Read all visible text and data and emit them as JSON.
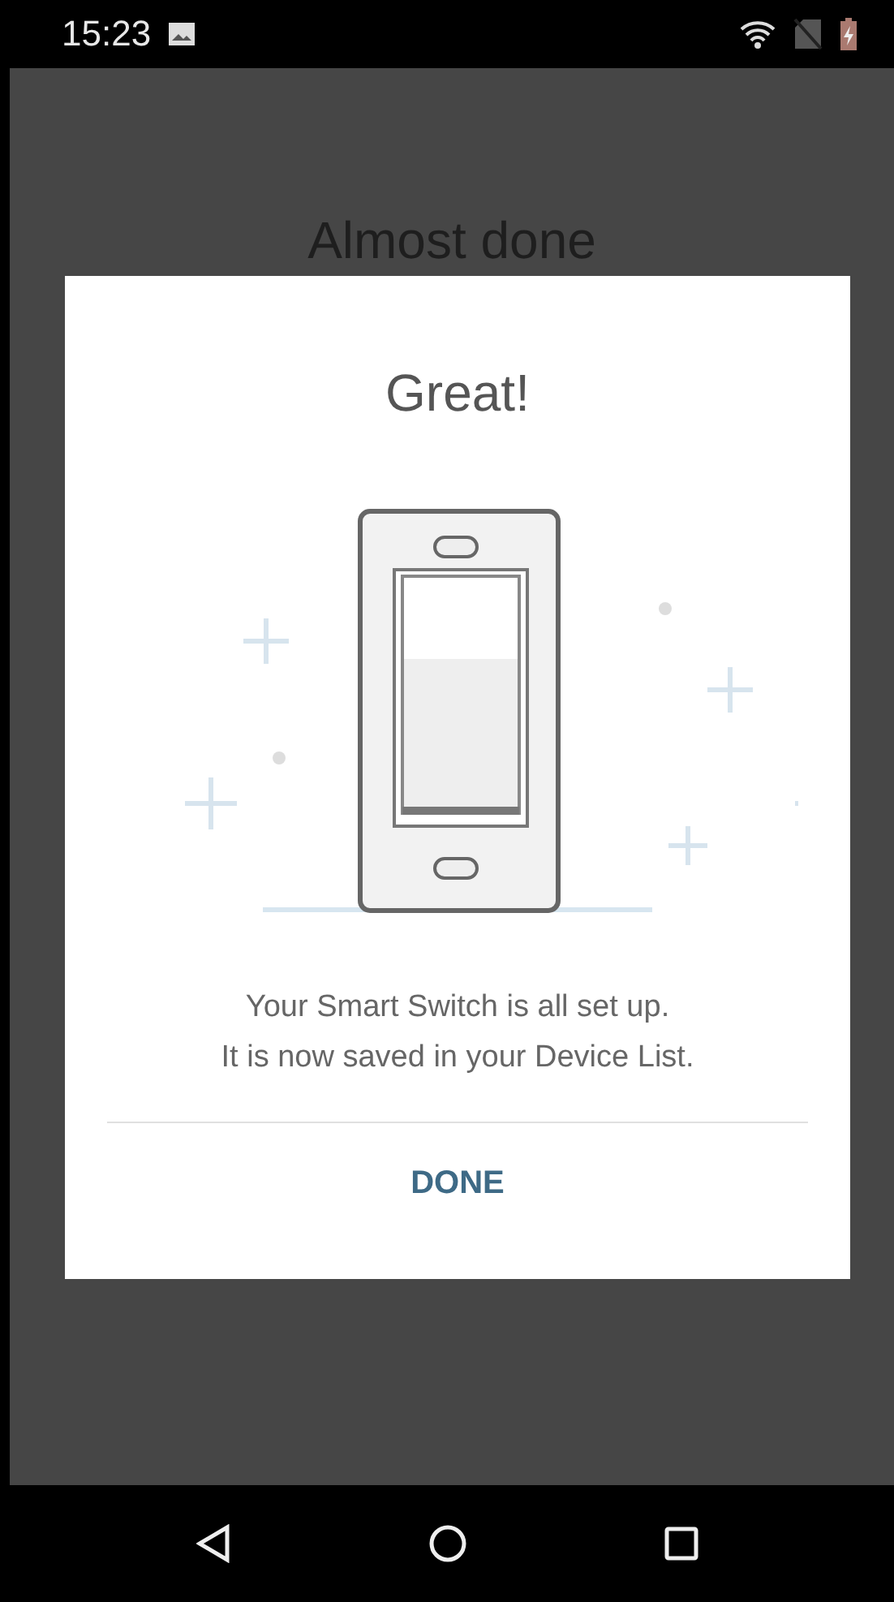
{
  "status_bar": {
    "time": "15:23"
  },
  "screen": {
    "title": "Almost done"
  },
  "dialog": {
    "title": "Great!",
    "message_lines": [
      "Your Smart Switch is all set up.",
      "It is now saved in your Device List."
    ],
    "button": "DONE"
  }
}
